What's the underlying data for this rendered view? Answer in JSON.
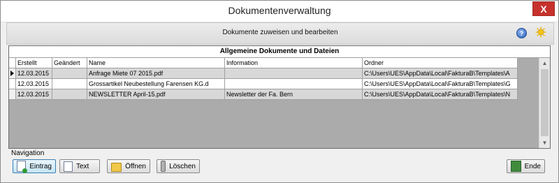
{
  "window": {
    "title": "Dokumentenverwaltung",
    "close_glyph": "X"
  },
  "header": {
    "subtitle": "Dokumente zuweisen und bearbeiten",
    "help_glyph": "?"
  },
  "table": {
    "caption": "Allgemeine Dokumente und Dateien",
    "columns": [
      "Erstellt",
      "Geändert",
      "Name",
      "Information",
      "Ordner"
    ],
    "rows": [
      {
        "erstellt": "12.03.2015",
        "geaendert": "",
        "name": "Anfrage Miete 07 2015.pdf",
        "information": "",
        "ordner": "C:\\Users\\UES\\AppData\\Local\\FakturaB\\Templates\\A"
      },
      {
        "erstellt": "12.03.2015",
        "geaendert": "",
        "name": "Grossartikel Neubestellung Farensen KG.d",
        "information": "",
        "ordner": "C:\\Users\\UES\\AppData\\Local\\FakturaB\\Templates\\G"
      },
      {
        "erstellt": "12.03.2015",
        "geaendert": "",
        "name": "NEWSLETTER April-15.pdf",
        "information": "Newsletter der Fa. Bern",
        "ordner": "C:\\Users\\UES\\AppData\\Local\\FakturaB\\Templates\\N"
      }
    ]
  },
  "navigation": {
    "label": "Navigation",
    "buttons": {
      "eintrag": "Eintrag",
      "text": "Text",
      "oeffnen": "Öffnen",
      "loeschen": "Löschen",
      "ende": "Ende"
    }
  },
  "colors": {
    "close": "#c7312c",
    "accent": "#3c7fb1",
    "row_highlight": "#d8d8d8"
  },
  "icons": [
    "close-icon",
    "help-icon",
    "settings-sun-icon",
    "add-entry-icon",
    "text-document-icon",
    "folder-open-icon",
    "delete-icon",
    "exit-icon"
  ]
}
